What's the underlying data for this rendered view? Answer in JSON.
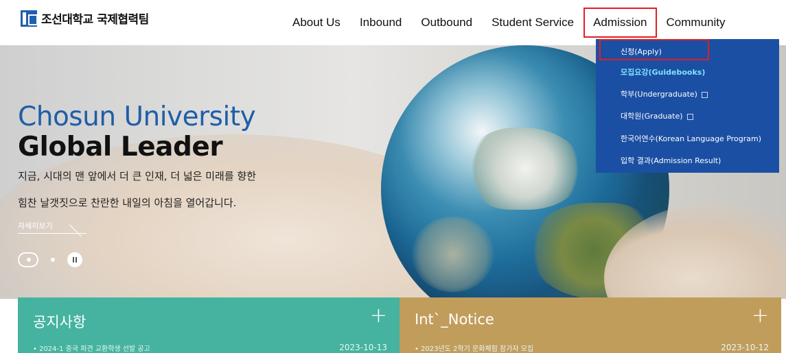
{
  "header": {
    "logo_text": "조선대학교 국제협력팀"
  },
  "nav": {
    "items": [
      {
        "label": "About Us"
      },
      {
        "label": "Inbound"
      },
      {
        "label": "Outbound"
      },
      {
        "label": "Student Service"
      },
      {
        "label": "Admission"
      },
      {
        "label": "Community"
      }
    ],
    "active_index": 4
  },
  "dropdown": {
    "items": [
      {
        "label": "신청(Apply)",
        "highlight": false,
        "external": false
      },
      {
        "label": "모집요강(Guidebooks)",
        "highlight": true,
        "external": false
      },
      {
        "label": "학부(Undergraduate)",
        "highlight": false,
        "external": true
      },
      {
        "label": "대학원(Graduate)",
        "highlight": false,
        "external": true
      },
      {
        "label": "한국어연수(Korean Language Program)",
        "highlight": false,
        "external": false
      },
      {
        "label": "입학 결과(Admission Result)",
        "highlight": false,
        "external": false
      }
    ]
  },
  "hero": {
    "title_line1": "Chosun University",
    "title_line2": "Global Leader",
    "desc_line1": "지금, 시대의 맨 앞에서 더 큰 인재, 더 넓은 미래를 향한",
    "desc_line2": "힘찬 날갯짓으로 찬란한 내일의 아침을 열어갑니다.",
    "more_label": "자세히보기"
  },
  "notices": {
    "left": {
      "title": "공지사항",
      "item": "• 2024-1 중국 파견 교환학생 선발 공고",
      "date": "2023-10-13"
    },
    "right": {
      "title": "Int`_Notice",
      "item": "• 2023년도 2학기 문화체험 참가자 모집",
      "date": "2023-10-12"
    }
  },
  "colors": {
    "brand_blue": "#1f5ea8",
    "dropdown_bg": "#1b4fa3",
    "highlight_red": "#e01e22",
    "notice_green": "#45b3a0",
    "notice_gold": "#c19d5c"
  }
}
